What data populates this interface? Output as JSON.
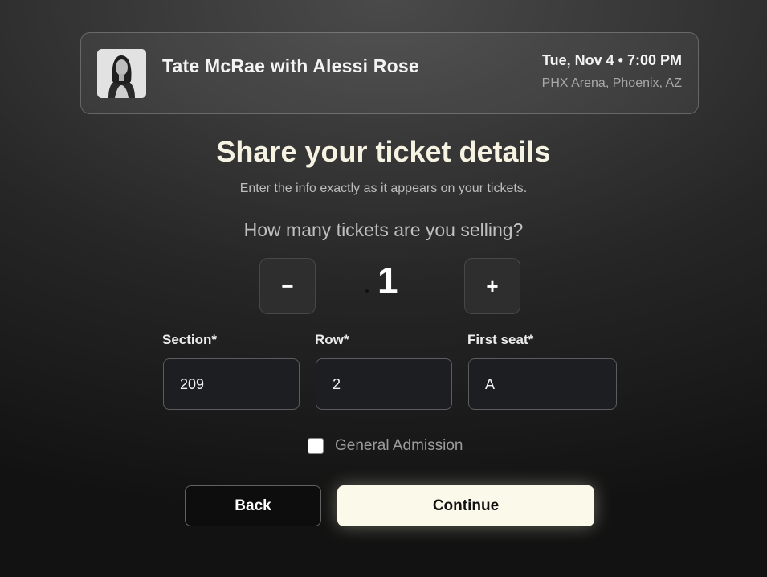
{
  "event": {
    "title": "Tate McRae with Alessi Rose",
    "date_time": "Tue, Nov 4 • 7:00 PM",
    "venue": "PHX Arena, Phoenix, AZ"
  },
  "page": {
    "title": "Share your ticket details",
    "subtitle": "Enter the info exactly as it appears on your tickets."
  },
  "quantity": {
    "question": "How many tickets are you selling?",
    "minus_label": "−",
    "plus_label": "+",
    "value": "1"
  },
  "fields": {
    "section": {
      "label": "Section*",
      "value": "209"
    },
    "row": {
      "label": "Row*",
      "value": "2"
    },
    "first_seat": {
      "label": "First seat*",
      "value": "A"
    }
  },
  "general_admission": {
    "label": "General Admission",
    "checked": false
  },
  "actions": {
    "back_label": "Back",
    "continue_label": "Continue"
  },
  "colors": {
    "accent_button": "#fbf9e9",
    "title_text": "#f7f3e3",
    "input_background": "#1d1e22"
  }
}
